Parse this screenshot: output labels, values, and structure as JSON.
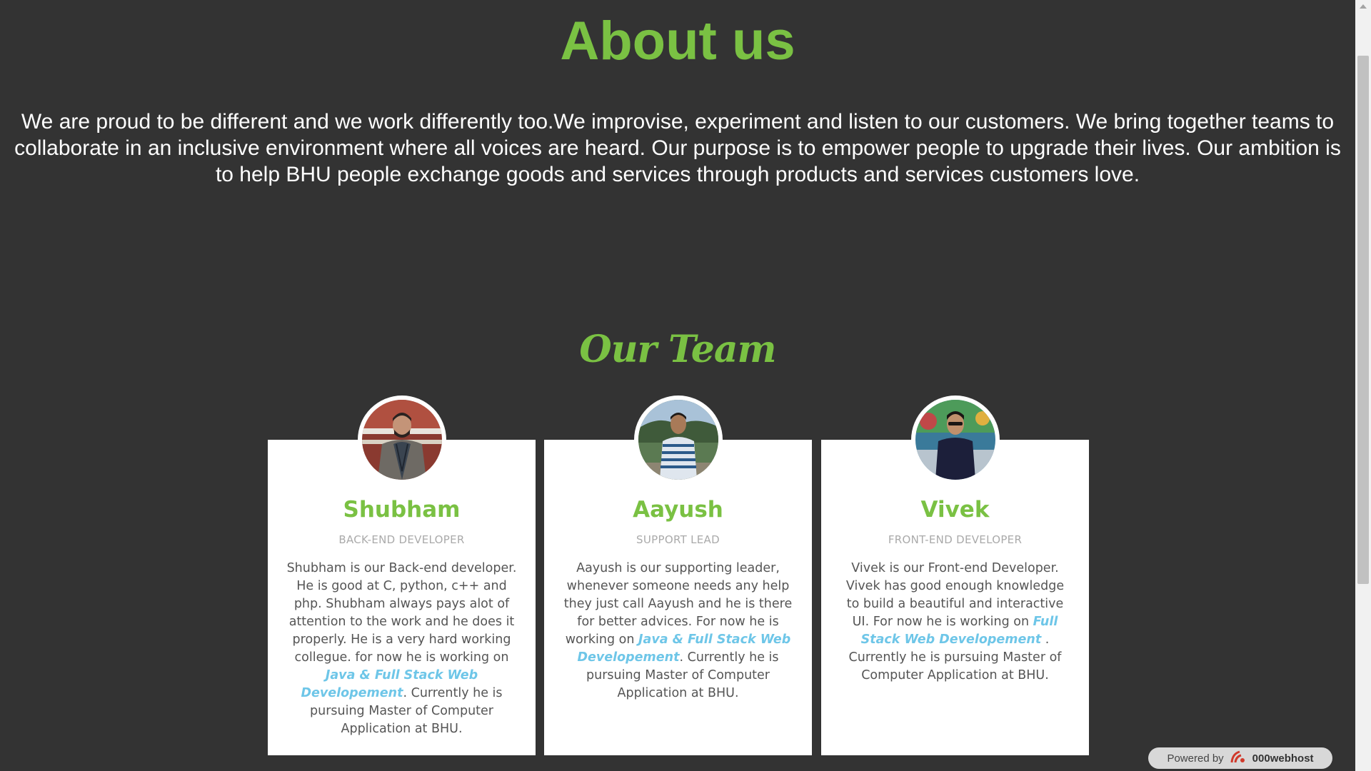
{
  "about": {
    "title": "About us",
    "text": "We are proud to be different and we work differently too.We improvise, experiment and listen to our customers. We bring together teams to collaborate in an inclusive environment where all voices are heard. Our purpose is to empower people to upgrade their lives. Our ambition is to help BHU people exchange goods and services through products and services customers love."
  },
  "team": {
    "title": "Our Team",
    "members": [
      {
        "name": "Shubham",
        "role": "Back-end Developer",
        "desc_before": "Shubham is our Back-end developer. He is good at C, python, c++ and php. Shubham always pays alot of attention to the work and he does it properly. He is a very hard working collegue. for now he is working on ",
        "link": "Java & Full Stack Web Developement",
        "desc_after": ". Currently he is pursuing Master of Computer Application at BHU."
      },
      {
        "name": "Aayush",
        "role": "Support Lead",
        "desc_before": "Aayush is our supporting leader, whenever someone needs any help they just call Aayush and he is there for better advices. For now he is working on ",
        "link": "Java & Full Stack Web Developement",
        "desc_after": ". Currently he is pursuing Master of Computer Application at BHU."
      },
      {
        "name": "Vivek",
        "role": "Front-end Developer",
        "desc_before": "Vivek is our Front-end Developer. Vivek has good enough knowledge to build a beautiful and interactive UI. For now he is working on ",
        "link": "Full Stack Web Developement",
        "desc_after": " . Currently he is pursuing Master of Computer Application at BHU."
      }
    ]
  },
  "badge": {
    "prefix": "Powered by",
    "brand": "000webhost"
  },
  "colors": {
    "background": "#333333",
    "accent": "#7ac143",
    "link": "#6ec6e8"
  }
}
